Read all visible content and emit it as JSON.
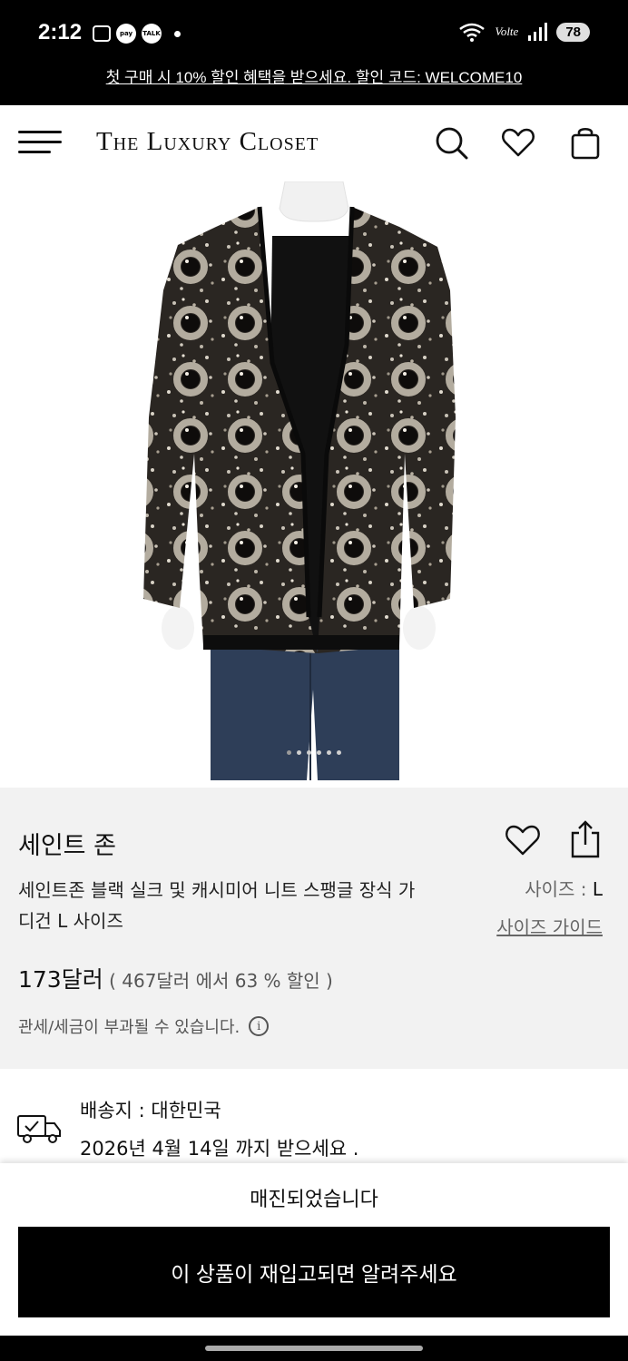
{
  "status": {
    "time": "2:12",
    "pay_badge": "pay",
    "talk_badge": "TALK",
    "network": "Volte",
    "signal_sup": "6",
    "battery": "78"
  },
  "promo": {
    "text": "첫 구매 시 10% 할인 혜택을 받으세요. 할인 코드: WELCOME10"
  },
  "header": {
    "logo": "The Luxury Closet"
  },
  "product": {
    "brand": "세인트 존",
    "title": "세인트존 블랙 실크 및 캐시미어 니트 스팽글 장식 가디건 L 사이즈",
    "size_label": "사이즈 : ",
    "size_value": "L",
    "size_guide": "사이즈 가이드",
    "price": "173달러",
    "original_price_text": "( 467달러  에서  63 % 할인 )",
    "duties_note": "관세/세금이 부과될 수 있습니다.",
    "gallery_dots": 6,
    "active_dot": 0
  },
  "shipping": {
    "destination": "배송지 : 대한민국",
    "delivery": "2026년 4월 14일 까지 받으세요 ."
  },
  "bottom": {
    "sold_out": "매진되었습니다",
    "notify_button": "이 상품이 재입고되면 알려주세요"
  },
  "colors": {
    "brand_black": "#000000",
    "panel_gray": "#f2f2f2",
    "jeans": "#2e3e58",
    "sequin_silver": "#a9a39a"
  }
}
